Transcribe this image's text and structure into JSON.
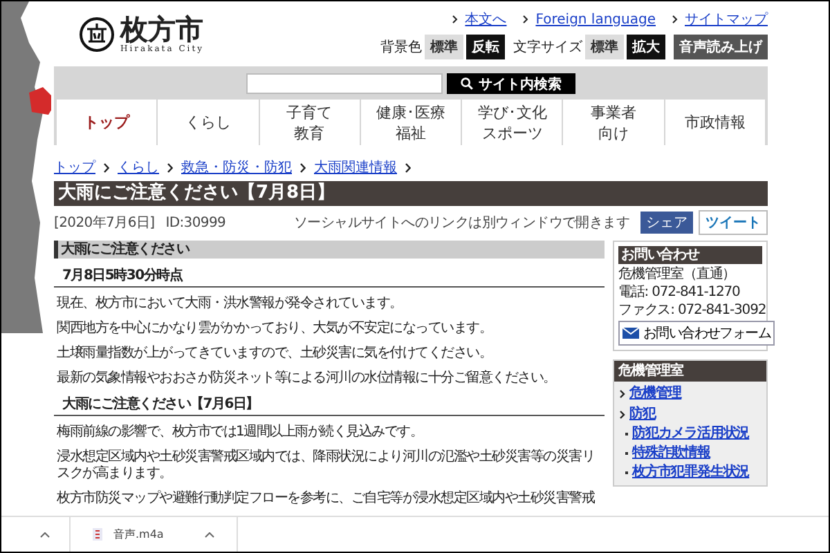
{
  "header": {
    "city_name": "枚方市",
    "city_name_roman": "Hirakata City",
    "top_links": [
      {
        "label": "本文へ"
      },
      {
        "label": "Foreign language"
      },
      {
        "label": "サイトマップ"
      }
    ],
    "settings": [
      {
        "label": "背景色",
        "options": [
          {
            "label": "標準",
            "kind": "plain"
          },
          {
            "label": "反転",
            "kind": "inverse"
          }
        ]
      },
      {
        "label": "文字サイズ",
        "options": [
          {
            "label": "標準",
            "kind": "plain"
          },
          {
            "label": "拡大",
            "kind": "inverse"
          }
        ]
      }
    ],
    "read_aloud_button": "音声読み上げ"
  },
  "search": {
    "button": "サイト内検索"
  },
  "nav_tabs": [
    {
      "lines": [
        "トップ"
      ],
      "selected": true
    },
    {
      "lines": [
        "くらし"
      ],
      "selected": false
    },
    {
      "lines": [
        "子育て",
        "教育"
      ],
      "selected": false
    },
    {
      "lines": [
        "健康･医療",
        "福祉"
      ],
      "selected": false
    },
    {
      "lines": [
        "学び･文化",
        "スポーツ"
      ],
      "selected": false
    },
    {
      "lines": [
        "事業者",
        "向け"
      ],
      "selected": false
    },
    {
      "lines": [
        "市政情報"
      ],
      "selected": false
    }
  ],
  "breadcrumb": [
    "トップ",
    "くらし",
    "救急・防災・防犯",
    "大雨関連情報"
  ],
  "page_title": "大雨にご注意ください【7月8日】",
  "date": "[2020年7月6日]",
  "page_id": "ID:30999",
  "social_note": "ソーシャルサイトへのリンクは別ウィンドウで開きます",
  "share_buttons": [
    {
      "label": "シェア",
      "kind": "facebook"
    },
    {
      "label": "ツイート",
      "kind": "twitter"
    }
  ],
  "sections": [
    {
      "kind": "heading3",
      "text": "大雨にご注意ください"
    },
    {
      "kind": "heading4",
      "text": "7月8日5時30分時点"
    },
    {
      "kind": "paragraph",
      "text": "現在、枚方市において大雨・洪水警報が発令されています。"
    },
    {
      "kind": "paragraph",
      "text": "関西地方を中心にかなり雲がかかっており、大気が不安定になっています。"
    },
    {
      "kind": "paragraph",
      "text": "土壌雨量指数が上がってきていますので、土砂災害に気を付けてください。"
    },
    {
      "kind": "paragraph",
      "text": "最新の気象情報やおおさか防災ネット等による河川の水位情報に十分ご留意ください。"
    },
    {
      "kind": "heading4",
      "text": "大雨にご注意ください【7月6日】"
    },
    {
      "kind": "paragraph",
      "text": "梅雨前線の影響で、枚方市では1週間以上雨が続く見込みです。"
    },
    {
      "kind": "paragraph",
      "text": "浸水想定区域内や土砂災害警戒区域内では、降雨状況により河川の氾濫や土砂災害等の災害リスクが高まります。"
    },
    {
      "kind": "paragraph",
      "text": "枚方市防災マップや避難行動判定フローを参考に、ご自宅等が浸水想定区域内や土砂災害警戒"
    }
  ],
  "contact": {
    "title": "お問い合わせ",
    "department": "危機管理室（直通）",
    "phone": "電話: 072-841-1270",
    "fax": "ファクス: 072-841-3092",
    "form_button": "お問い合わせフォーム"
  },
  "side_menu": {
    "title": "危機管理室",
    "items": [
      {
        "label": "危機管理"
      },
      {
        "label": "防犯",
        "children": [
          {
            "label": "防犯カメラ活用状況"
          },
          {
            "label": "特殊詐欺情報"
          },
          {
            "label": "枚方市犯罪発生状況"
          }
        ]
      }
    ]
  },
  "download_bar": {
    "file_name": "音声.m4a"
  }
}
